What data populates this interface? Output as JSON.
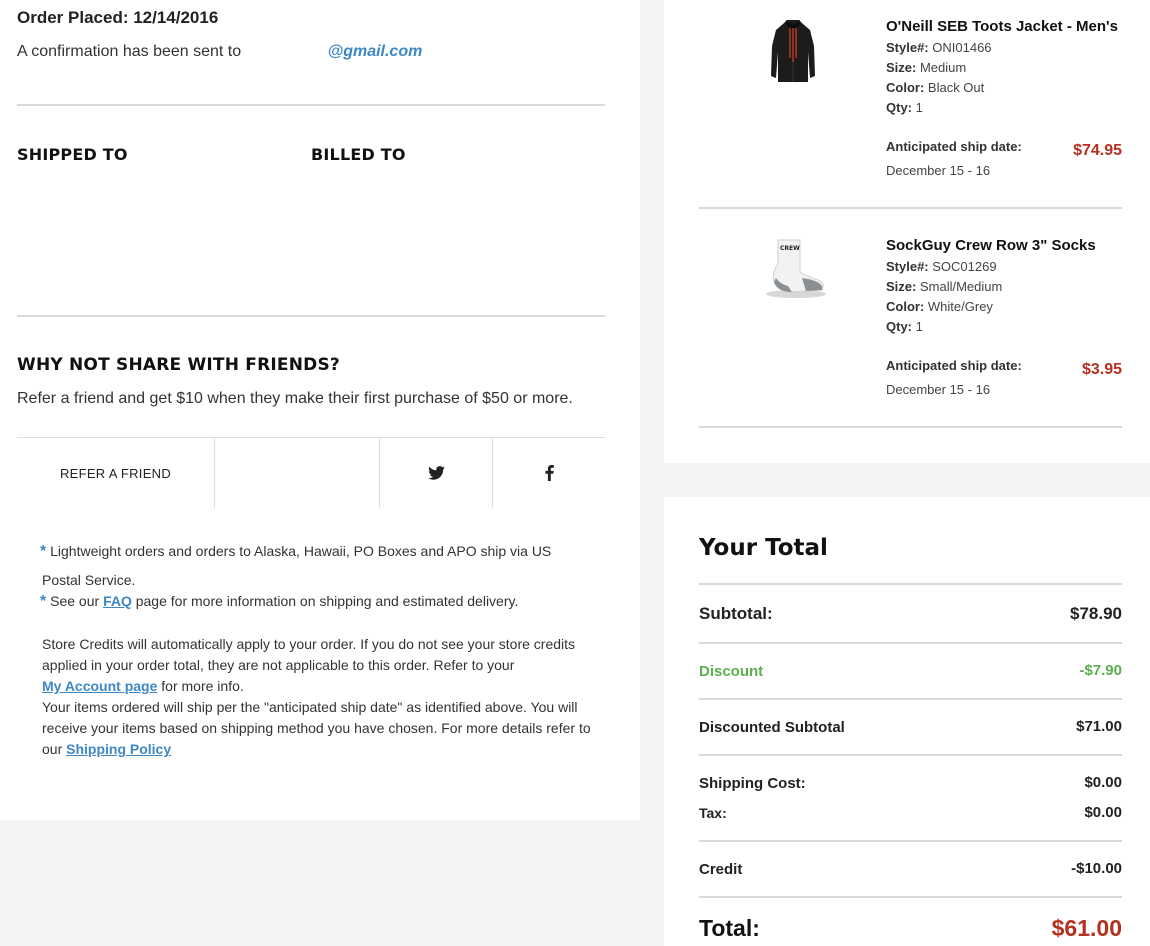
{
  "order": {
    "placed_label": "Order Placed: 12/14/2016",
    "confirmation_text": "A confirmation has been sent to",
    "email": "@gmail.com"
  },
  "addresses": {
    "shipped_to": "SHIPPED TO",
    "billed_to": "BILLED TO"
  },
  "share": {
    "title": "WHY NOT SHARE WITH FRIENDS?",
    "text": "Refer a friend and get $10 when they make their first purchase of $50 or more.",
    "refer_button": "REFER A FRIEND",
    "twitter_icon": "twitter-icon",
    "facebook_icon": "facebook-icon"
  },
  "notes": {
    "star": "*",
    "note1": "Lightweight orders and orders to Alaska, Hawaii, PO Boxes and APO ship via US Postal Service.",
    "note2_pre": "See our ",
    "note2_link": "FAQ",
    "note2_post": " page for more information on shipping and estimated delivery.",
    "store_credit_1": "Store Credits will automatically apply to your order. If you do not see your store credits applied in your order total, they are not applicable to this order. Refer to your",
    "my_account_link": "My Account page",
    "store_credit_2": " for more info.",
    "ship_policy_text": "Your items ordered will ship per the \"anticipated ship date\" as identified above. You will receive your items based on shipping method you have chosen. For more details refer to our ",
    "shipping_policy_link": "Shipping Policy"
  },
  "items": [
    {
      "name": "O'Neill SEB Toots Jacket - Men's",
      "style_label": "Style#:",
      "style": "ONI01466",
      "size_label": "Size:",
      "size": "Medium",
      "color_label": "Color:",
      "color": "Black Out",
      "qty_label": "Qty:",
      "qty": "1",
      "ship_label": "Anticipated ship date:",
      "ship_date": "December 15 - 16",
      "price": "$74.95"
    },
    {
      "name": "SockGuy Crew Row 3\" Socks",
      "style_label": "Style#:",
      "style": "SOC01269",
      "size_label": "Size:",
      "size": "Small/Medium",
      "color_label": "Color:",
      "color": "White/Grey",
      "qty_label": "Qty:",
      "qty": "1",
      "ship_label": "Anticipated ship date:",
      "ship_date": "December 15 - 16",
      "price": "$3.95",
      "image_text": "CREW"
    }
  ],
  "totals": {
    "title": "Your Total",
    "subtotal_label": "Subtotal:",
    "subtotal": "$78.90",
    "discount_label": "Discount",
    "discount": "-$7.90",
    "discounted_subtotal_label": "Discounted Subtotal",
    "discounted_subtotal": "$71.00",
    "shipping_label": "Shipping Cost:",
    "shipping": "$0.00",
    "tax_label": "Tax:",
    "tax": "$0.00",
    "credit_label": "Credit",
    "credit": "-$10.00",
    "total_label": "Total:",
    "total": "$61.00"
  },
  "colors": {
    "link": "#3d87c4",
    "price": "#b5301e",
    "discount": "#5cae4f"
  }
}
